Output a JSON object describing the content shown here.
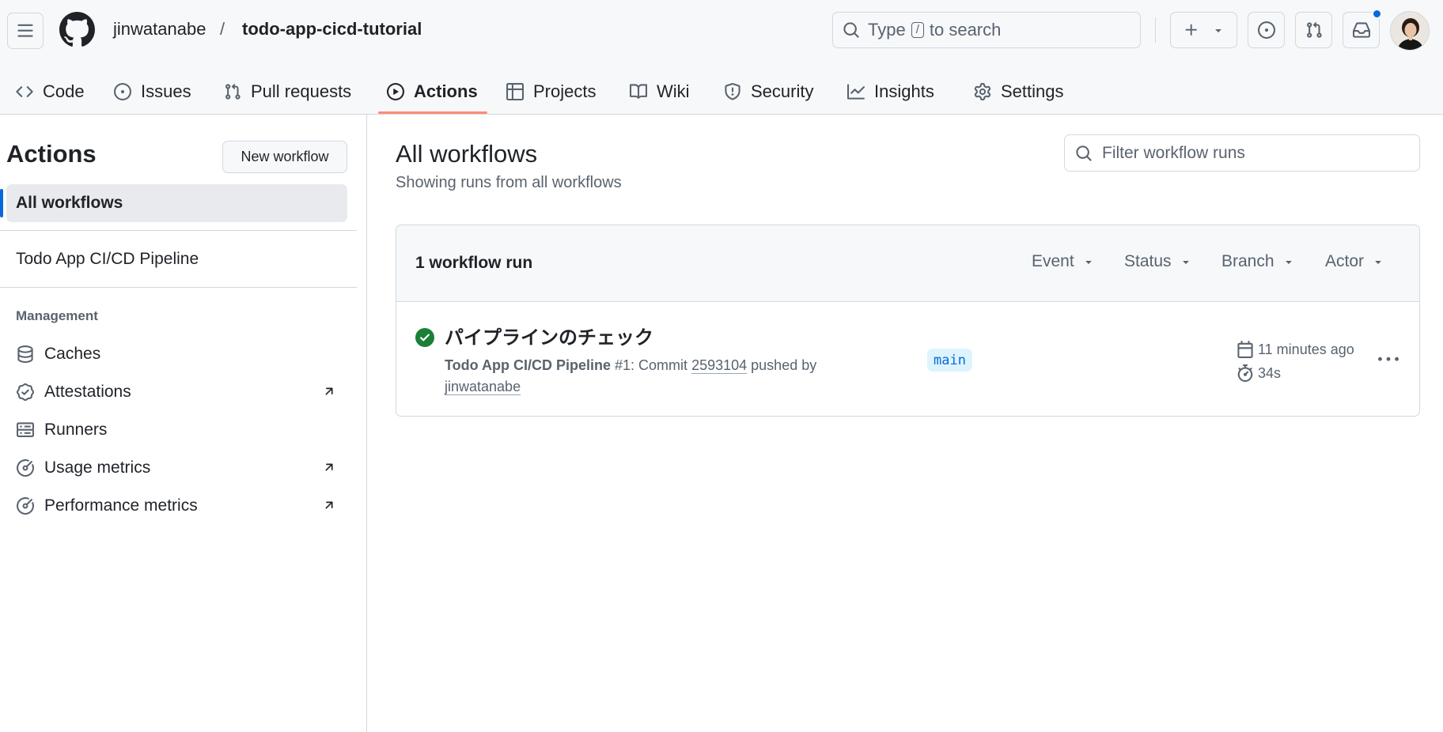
{
  "repo": {
    "owner": "jinwatanabe",
    "separator": "/",
    "name": "todo-app-cicd-tutorial"
  },
  "search": {
    "prefix": "Type",
    "key": "/",
    "suffix": "to search"
  },
  "nav": {
    "tabs": [
      {
        "label": "Code",
        "icon": "code-icon"
      },
      {
        "label": "Issues",
        "icon": "issue-icon"
      },
      {
        "label": "Pull requests",
        "icon": "pull-request-icon"
      },
      {
        "label": "Actions",
        "icon": "play-icon",
        "active": true
      },
      {
        "label": "Projects",
        "icon": "table-icon"
      },
      {
        "label": "Wiki",
        "icon": "book-icon"
      },
      {
        "label": "Security",
        "icon": "shield-icon"
      },
      {
        "label": "Insights",
        "icon": "graph-icon"
      },
      {
        "label": "Settings",
        "icon": "gear-icon"
      }
    ]
  },
  "sidebar": {
    "title": "Actions",
    "new_workflow_label": "New workflow",
    "all_workflows_label": "All workflows",
    "workflows": [
      "Todo App CI/CD Pipeline"
    ],
    "management_heading": "Management",
    "management_items": [
      {
        "label": "Caches",
        "icon": "database-icon",
        "external": false
      },
      {
        "label": "Attestations",
        "icon": "verified-icon",
        "external": true
      },
      {
        "label": "Runners",
        "icon": "server-icon",
        "external": false
      },
      {
        "label": "Usage metrics",
        "icon": "meter-icon",
        "external": true
      },
      {
        "label": "Performance metrics",
        "icon": "meter-icon",
        "external": true
      }
    ]
  },
  "main": {
    "title": "All workflows",
    "subtitle": "Showing runs from all workflows",
    "filter_placeholder": "Filter workflow runs",
    "runs_count_label": "1 workflow run",
    "filters": [
      "Event",
      "Status",
      "Branch",
      "Actor"
    ],
    "runs": [
      {
        "title": "パイプラインのチェック",
        "status": "success",
        "workflow_name": "Todo App CI/CD Pipeline",
        "run_number": "#1",
        "commit_prefix": ": Commit",
        "commit_sha": "2593104",
        "pushed_by_text": "pushed by",
        "actor": "jinwatanabe",
        "branch": "main",
        "time_ago": "11 minutes ago",
        "duration": "34s"
      }
    ]
  },
  "colors": {
    "accent": "#0969da",
    "success": "#1a7f37",
    "active_tab_underline": "#fd8c73",
    "header_bg": "#f6f8fa"
  }
}
